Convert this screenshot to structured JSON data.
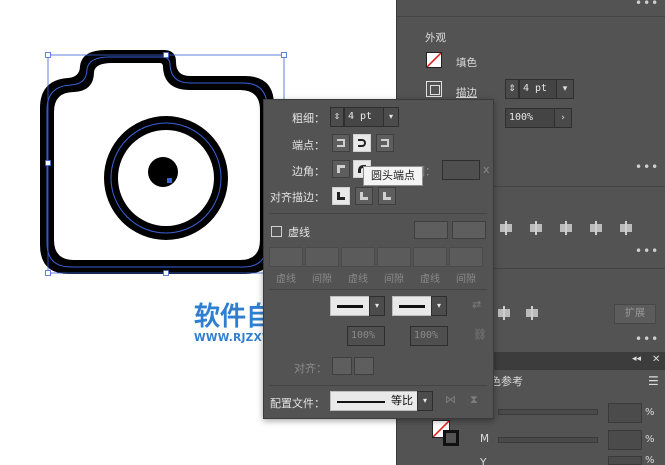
{
  "canvas": {
    "watermark_title": "软件自学网",
    "watermark_url": "WWW.RJZXW.COM"
  },
  "appearance_panel": {
    "title": "外观",
    "fill_label": "填色",
    "stroke_label": "描边",
    "stroke_weight": "4 pt",
    "opacity_value": "100%",
    "menu_dots": "•••"
  },
  "pathfinder": {
    "expand_label": "扩展"
  },
  "color_guide": {
    "tab_label": "色参考",
    "channel_m": "M",
    "channel_y": "Y",
    "pct_symbol": "%"
  },
  "stroke_panel": {
    "weight_label": "粗细：",
    "weight_value": "4 pt",
    "cap_label": "端点：",
    "corner_label": "边角：",
    "limit_label": "限制：",
    "limit_suffix": "x",
    "align_label": "对齐描边：",
    "dashed_label": "虚线",
    "dash_labels": [
      "虚线",
      "间隙",
      "虚线",
      "间隙",
      "虚线",
      "间隙"
    ],
    "scale_1": "100%",
    "scale_2": "100%",
    "align_row_label": "对齐：",
    "profile_label": "配置文件：",
    "profile_value": "等比"
  },
  "tooltip": {
    "text": "圆头端点"
  }
}
